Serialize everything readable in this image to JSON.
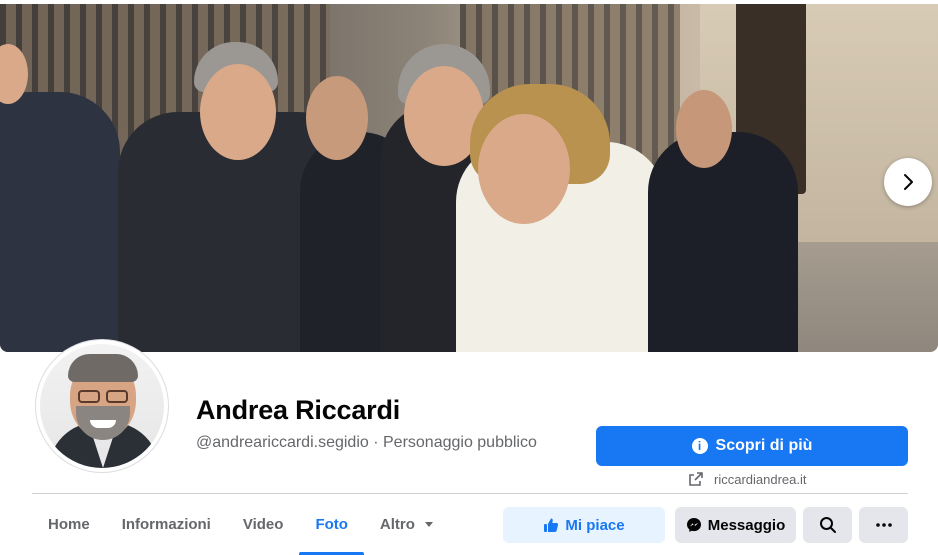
{
  "cover": {
    "next_icon": "chevron-right-icon"
  },
  "profile": {
    "name": "Andrea Riccardi",
    "subtitle": "@andreariccardi.segidio · Personaggio pubblico"
  },
  "cta": {
    "label": "Scopri di più",
    "icon": "info-icon"
  },
  "website": {
    "icon": "external-link-icon",
    "label": "riccardiandrea.it"
  },
  "tabs": [
    {
      "label": "Home",
      "active": false
    },
    {
      "label": "Informazioni",
      "active": false
    },
    {
      "label": "Video",
      "active": false
    },
    {
      "label": "Foto",
      "active": true
    },
    {
      "label": "Altro",
      "active": false
    }
  ],
  "actions": {
    "like_label": "Mi piace",
    "message_label": "Messaggio",
    "search_icon": "search-icon",
    "more_icon": "more-icon"
  },
  "colors": {
    "accent": "#1877f2",
    "muted": "#65676b",
    "button_bg": "#e4e6eb"
  }
}
